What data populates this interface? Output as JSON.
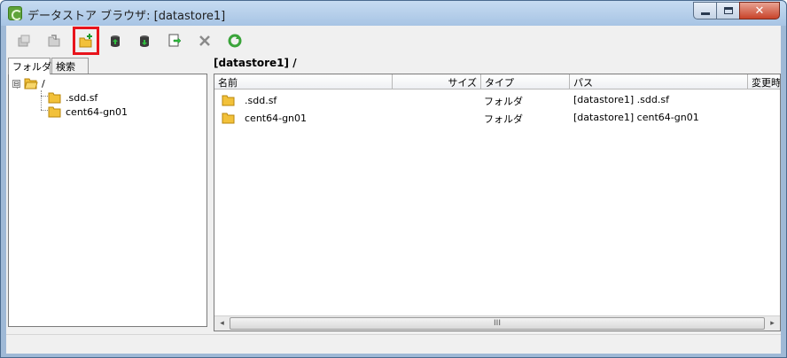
{
  "window": {
    "title": "データストア ブラウザ: [datastore1]"
  },
  "toolbar": {
    "buttons": [
      {
        "name": "upload-folder-icon"
      },
      {
        "name": "refresh-folder-icon"
      },
      {
        "name": "new-folder-icon"
      },
      {
        "name": "upload-icon"
      },
      {
        "name": "download-icon"
      },
      {
        "name": "register-vm-icon"
      },
      {
        "name": "delete-icon"
      },
      {
        "name": "refresh-icon"
      }
    ]
  },
  "tabs": {
    "folders": "フォルダ",
    "search": "検索"
  },
  "tree": {
    "root": "/",
    "expander": "⊟",
    "children": [
      ".sdd.sf",
      "cent64-gn01"
    ]
  },
  "path_label": "[datastore1] /",
  "table": {
    "headers": {
      "name": "名前",
      "size": "サイズ",
      "type": "タイプ",
      "path": "パス",
      "modified": "変更時"
    },
    "rows": [
      {
        "name": ".sdd.sf",
        "size": "",
        "type": "フォルダ",
        "path": "[datastore1] .sdd.sf"
      },
      {
        "name": "cent64-gn01",
        "size": "",
        "type": "フォルダ",
        "path": "[datastore1] cent64-gn01"
      }
    ]
  },
  "scrollbar": {
    "left_arrow": "◂",
    "right_arrow": "▸",
    "grip": "III"
  },
  "colors": {
    "highlight": "#e8141c",
    "folder": "#f2c13a",
    "titlebar": "#b6cfeb"
  }
}
